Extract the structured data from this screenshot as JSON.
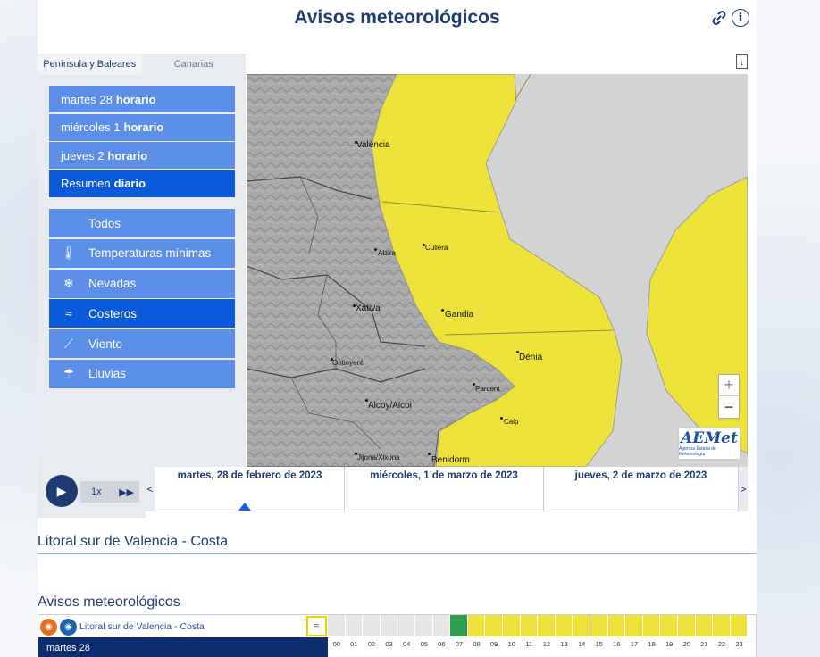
{
  "header": {
    "title": "Avisos meteorológicos",
    "link_icon": "link-icon",
    "info_icon": "info-icon"
  },
  "region_tabs": [
    {
      "label": "Península y Baleares",
      "active": true
    },
    {
      "label": "Canarias",
      "active": false
    }
  ],
  "day_buttons": [
    {
      "day": "martes 28",
      "mode": "horario",
      "active": false
    },
    {
      "day": "miércoles 1",
      "mode": "horario",
      "active": false
    },
    {
      "day": "jueves 2",
      "mode": "horario",
      "active": false
    },
    {
      "day": "Resumen",
      "mode": "diario",
      "active": true
    }
  ],
  "type_buttons": [
    {
      "label": "Todos",
      "icon": "",
      "active": false
    },
    {
      "label": "Temperaturas mínimas",
      "icon": "thermometer-icon",
      "active": false
    },
    {
      "label": "Nevadas",
      "icon": "snowflake-icon",
      "active": false
    },
    {
      "label": "Costeros",
      "icon": "waves-icon",
      "active": true
    },
    {
      "label": "Viento",
      "icon": "wind-icon",
      "active": false
    },
    {
      "label": "Lluvias",
      "icon": "rain-icon",
      "active": false
    }
  ],
  "map": {
    "places": [
      "València",
      "Alzira",
      "Cullera",
      "Xàtiva",
      "Gandia",
      "Dénia",
      "Ontinyent",
      "Parcent",
      "Alcoy/Alcoi",
      "Calp",
      "Jijona/Xixona",
      "Benidorm"
    ],
    "zoom_in": "+",
    "zoom_out": "−",
    "logo": {
      "name": "AEMet",
      "subtitle": "Agencia Estatal de Meteorología"
    },
    "colors": {
      "warning_yellow": "#ede13a",
      "sea": "#d3d3d3",
      "land": "#a8a8a8"
    }
  },
  "player": {
    "speed": "1x",
    "play_icon": "play-icon",
    "forward_icon": "fast-forward-icon"
  },
  "timeline": {
    "prev": "<",
    "next": ">",
    "days": [
      "martes, 28 de febrero de 2023",
      "miércoles, 1 de marzo de 2023",
      "jueves, 2 de marzo de 2023"
    ]
  },
  "zone_title": "Litoral sur de Valencia - Costa",
  "warnings_title": "Avisos meteorológicos",
  "table": {
    "zone": "Litoral sur de Valencia - Costa",
    "day": "martes 28",
    "hours": [
      "00",
      "01",
      "02",
      "03",
      "04",
      "05",
      "06",
      "07",
      "08",
      "09",
      "10",
      "11",
      "12",
      "13",
      "14",
      "15",
      "16",
      "17",
      "18",
      "19",
      "20",
      "21",
      "22",
      "23"
    ],
    "levels": [
      "none",
      "none",
      "none",
      "none",
      "none",
      "none",
      "none",
      "green",
      "yellow",
      "yellow",
      "yellow",
      "yellow",
      "yellow",
      "yellow",
      "yellow",
      "yellow",
      "yellow",
      "yellow",
      "yellow",
      "yellow",
      "yellow",
      "yellow",
      "yellow",
      "yellow"
    ],
    "level_colors": {
      "none": "#e6e6e6",
      "green": "#2e9e4f",
      "yellow": "#ede13a"
    }
  }
}
